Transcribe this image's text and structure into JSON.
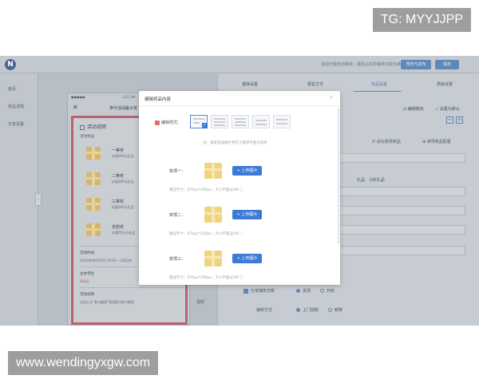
{
  "watermarks": {
    "top": "TG: MYYJJPP",
    "bottom": "www.wendingyxgw.com"
  },
  "topbar": {
    "logo": "N",
    "hint": "活动已经自动保存，最后以实际保存内容为准",
    "preview_label": "预览与发布",
    "save_label": "保存"
  },
  "sidebar": {
    "items": [
      {
        "label": "首页"
      },
      {
        "label": "奖品详情"
      },
      {
        "label": "分享设置"
      }
    ],
    "collapse_glyph": "‹"
  },
  "phone": {
    "status_left": "●●●●●",
    "status_time": "1:21 AM",
    "close_glyph": "✕",
    "title": "参与活动赢大奖",
    "card_title": "活动说明",
    "prizes_label": "活动奖品",
    "prizes": [
      {
        "name": "一等奖",
        "desc": "价值500元礼品"
      },
      {
        "name": "二等奖",
        "desc": "价值300元礼品"
      },
      {
        "name": "三等奖",
        "desc": "价值100元礼品"
      },
      {
        "name": "安慰奖",
        "desc": "价值50元小礼品"
      }
    ],
    "time_label": "活动时间",
    "time_value": "2023年09月25日 19:50 ~ 2023年",
    "organizer_label": "主办单位",
    "organizer_value": "昇图云",
    "desc_label": "活动说明",
    "desc_value": "点击上方“参与抽奖”按钮即可参与抽奖"
  },
  "middle": {
    "label": "视频"
  },
  "right_panel": {
    "tabs": [
      {
        "label": "基础设置",
        "active": false
      },
      {
        "label": "报名方式",
        "active": false
      },
      {
        "label": "奖品设置",
        "active": true
      },
      {
        "label": "高级设置",
        "active": false
      }
    ],
    "links": {
      "edit_template": "⇄ 编辑模块",
      "set_default": "✓ 设置为默认"
    },
    "section_links": {
      "set_prize": "⟳ 设为奖项奖品",
      "unit": "⊕ 单项奖品配置"
    },
    "gift_options": [
      "礼品",
      "O实礼品"
    ],
    "share_label": "分享抽奖次数",
    "share_options": [
      "关闭",
      "开启"
    ],
    "method_label": "抽奖方式",
    "method_options": [
      "上门自取",
      "邮寄"
    ]
  },
  "modal": {
    "title": "编辑奖品内容",
    "close_glyph": "×",
    "style_label": "编辑样式：",
    "hint": "注：该处奖品图片将在小程序中显示同步",
    "prize_rows": [
      {
        "label": "奖项一：",
        "upload": "+ 上传图片",
        "size": "建议尺寸：470px*350px，大小不超过1M ⓘ"
      },
      {
        "label": "奖项二：",
        "upload": "+ 上传图片",
        "size": "建议尺寸：470px*350px，大小不超过1M ⓘ"
      },
      {
        "label": "奖项三：",
        "upload": "+ 上传图片",
        "size": "建议尺寸：470px*350px，大小不超过1M ⓘ"
      }
    ],
    "style_check": "✓"
  },
  "colors": {
    "accent": "#3b7bd7",
    "overlay": "#b7bec6",
    "brand_red": "#e06d6d",
    "gift_gold": "#efd37e"
  },
  "icons": [
    "logo-icon",
    "close-icon",
    "gift-icon",
    "upload-icon",
    "check-icon",
    "info-icon",
    "swap-icon",
    "radio-icon"
  ]
}
